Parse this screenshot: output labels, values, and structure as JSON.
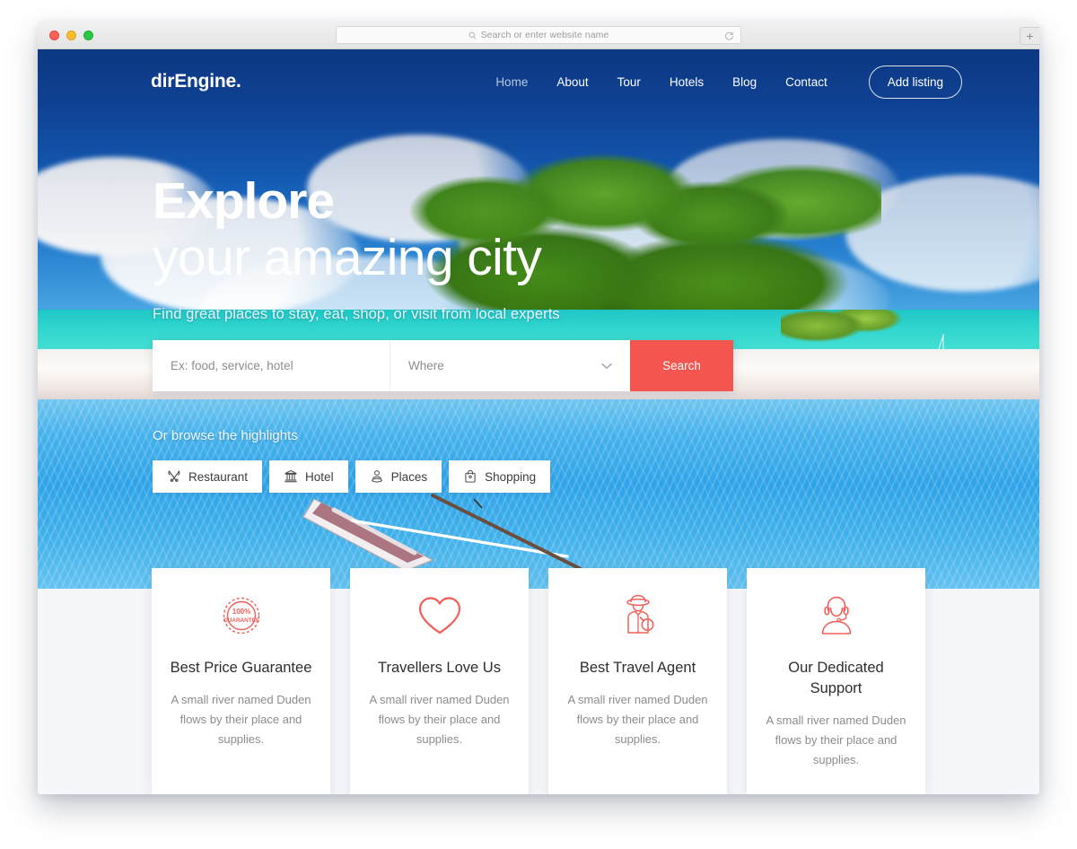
{
  "browser": {
    "url_placeholder": "Search or enter website name",
    "search_icon": "search-icon",
    "reload_icon": "reload-icon",
    "new_tab_label": "+"
  },
  "nav": {
    "logo": "dirEngine.",
    "links": [
      {
        "label": "Home",
        "active": true
      },
      {
        "label": "About",
        "active": false
      },
      {
        "label": "Tour",
        "active": false
      },
      {
        "label": "Hotels",
        "active": false
      },
      {
        "label": "Blog",
        "active": false
      },
      {
        "label": "Contact",
        "active": false
      }
    ],
    "cta_label": "Add listing"
  },
  "hero": {
    "title_line1": "Explore",
    "title_line2": "your amazing city",
    "subtitle": "Find great places to stay, eat, shop, or visit from local experts"
  },
  "search": {
    "keyword_placeholder": "Ex: food, service, hotel",
    "keyword_value": "",
    "location_label": "Where",
    "location_chevron": "chevron-down-icon",
    "button_label": "Search",
    "button_color": "#f4564f"
  },
  "highlights": {
    "label": "Or browse the highlights",
    "chips": [
      {
        "label": "Restaurant",
        "icon": "cutlery-icon"
      },
      {
        "label": "Hotel",
        "icon": "building-icon"
      },
      {
        "label": "Places",
        "icon": "person-pin-icon"
      },
      {
        "label": "Shopping",
        "icon": "shopping-bag-icon"
      }
    ]
  },
  "features": {
    "accent_color": "#f0605a",
    "cards": [
      {
        "icon": "guarantee-badge-icon",
        "badge_top": "100%",
        "badge_bottom": "GUARANTEE",
        "title": "Best Price Guarantee",
        "text": "A small river named Duden flows by their place and supplies."
      },
      {
        "icon": "heart-icon",
        "title": "Travellers Love Us",
        "text": "A small river named Duden flows by their place and supplies."
      },
      {
        "icon": "travel-agent-icon",
        "title": "Best Travel Agent",
        "text": "A small river named Duden flows by their place and supplies."
      },
      {
        "icon": "support-headset-icon",
        "title": "Our Dedicated Support",
        "text": "A small river named Duden flows by their place and supplies."
      }
    ]
  }
}
